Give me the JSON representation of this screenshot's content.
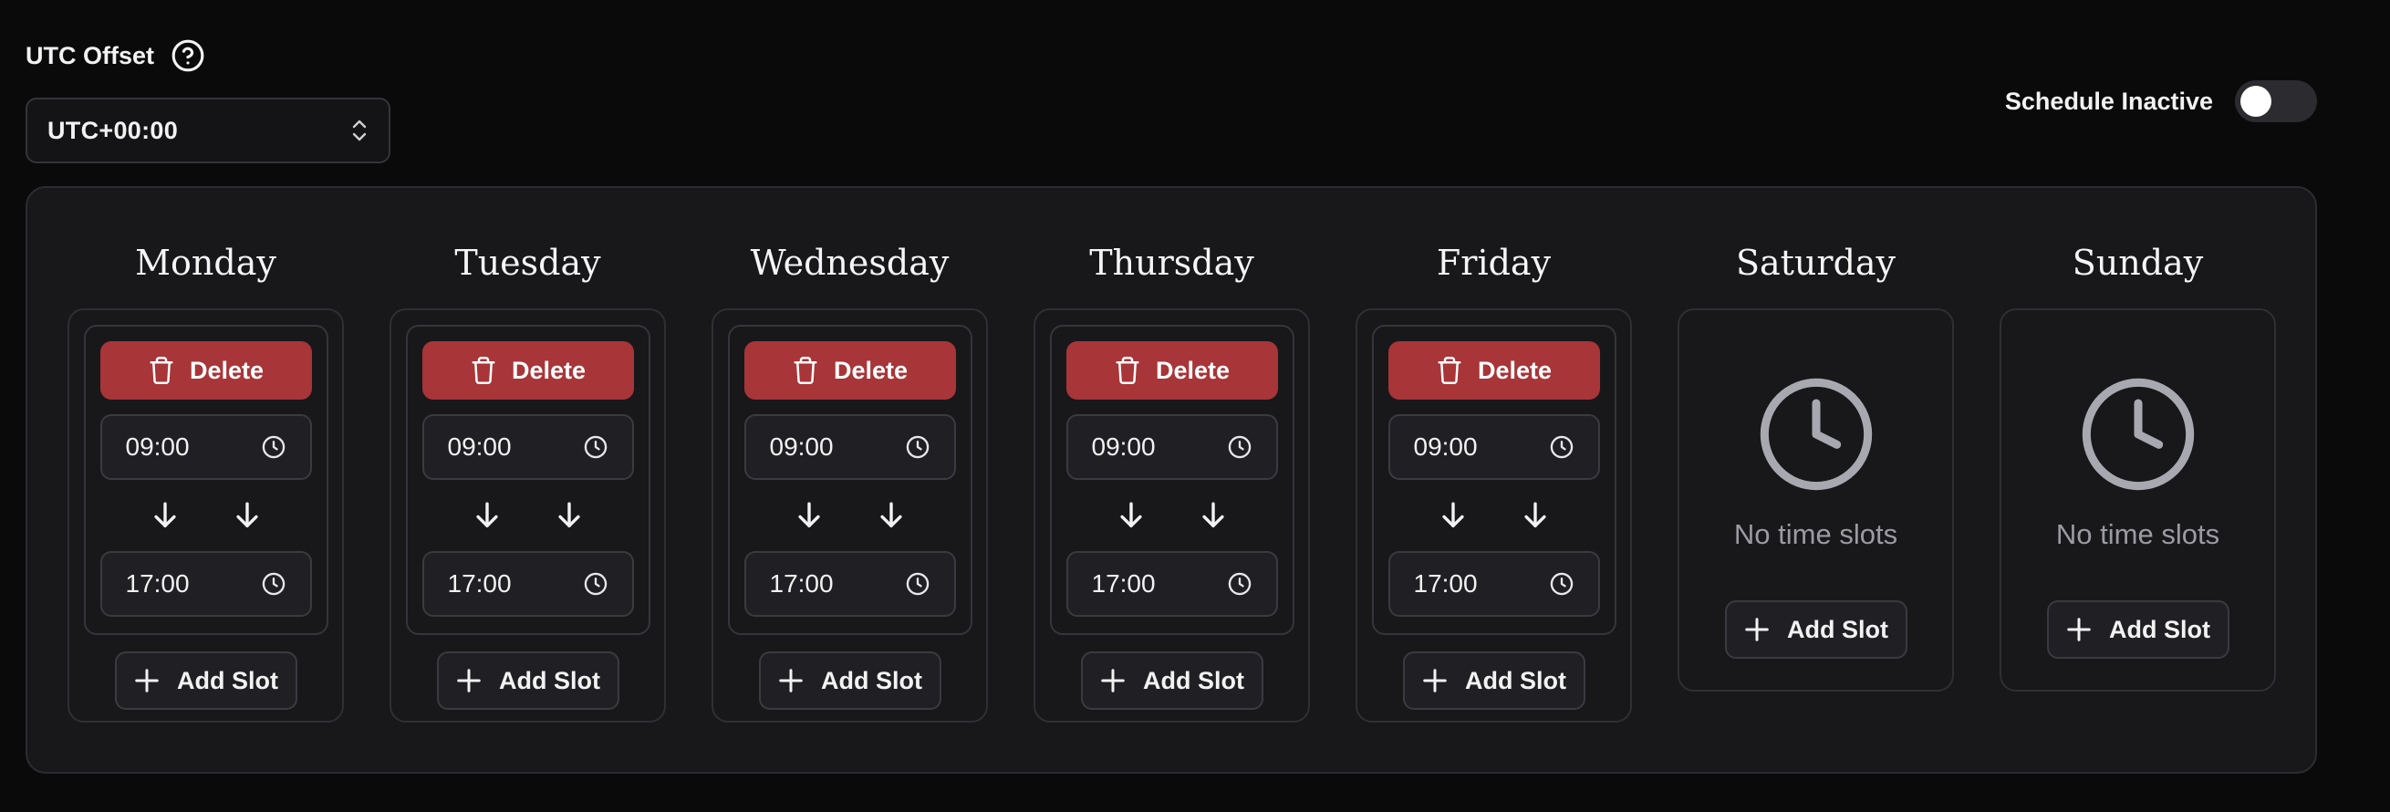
{
  "header": {
    "utc_label": "UTC Offset",
    "utc_value": "UTC+00:00",
    "schedule_label": "Schedule Inactive"
  },
  "icons": {
    "help": "help-circle-icon",
    "select": "chevrons-up-down-icon",
    "delete": "trash-icon",
    "clock": "clock-icon",
    "arrow": "arrow-down-icon",
    "add": "plus-icon"
  },
  "colors": {
    "delete": "#a83538",
    "background": "#0a0a0b",
    "panel": "#18181b"
  },
  "labels": {
    "delete": "Delete",
    "add_slot": "Add Slot",
    "no_slots": "No time slots"
  },
  "days": [
    {
      "name": "Monday",
      "slots": [
        {
          "start": "09:00",
          "end": "17:00"
        }
      ]
    },
    {
      "name": "Tuesday",
      "slots": [
        {
          "start": "09:00",
          "end": "17:00"
        }
      ]
    },
    {
      "name": "Wednesday",
      "slots": [
        {
          "start": "09:00",
          "end": "17:00"
        }
      ]
    },
    {
      "name": "Thursday",
      "slots": [
        {
          "start": "09:00",
          "end": "17:00"
        }
      ]
    },
    {
      "name": "Friday",
      "slots": [
        {
          "start": "09:00",
          "end": "17:00"
        }
      ]
    },
    {
      "name": "Saturday",
      "slots": []
    },
    {
      "name": "Sunday",
      "slots": []
    }
  ]
}
